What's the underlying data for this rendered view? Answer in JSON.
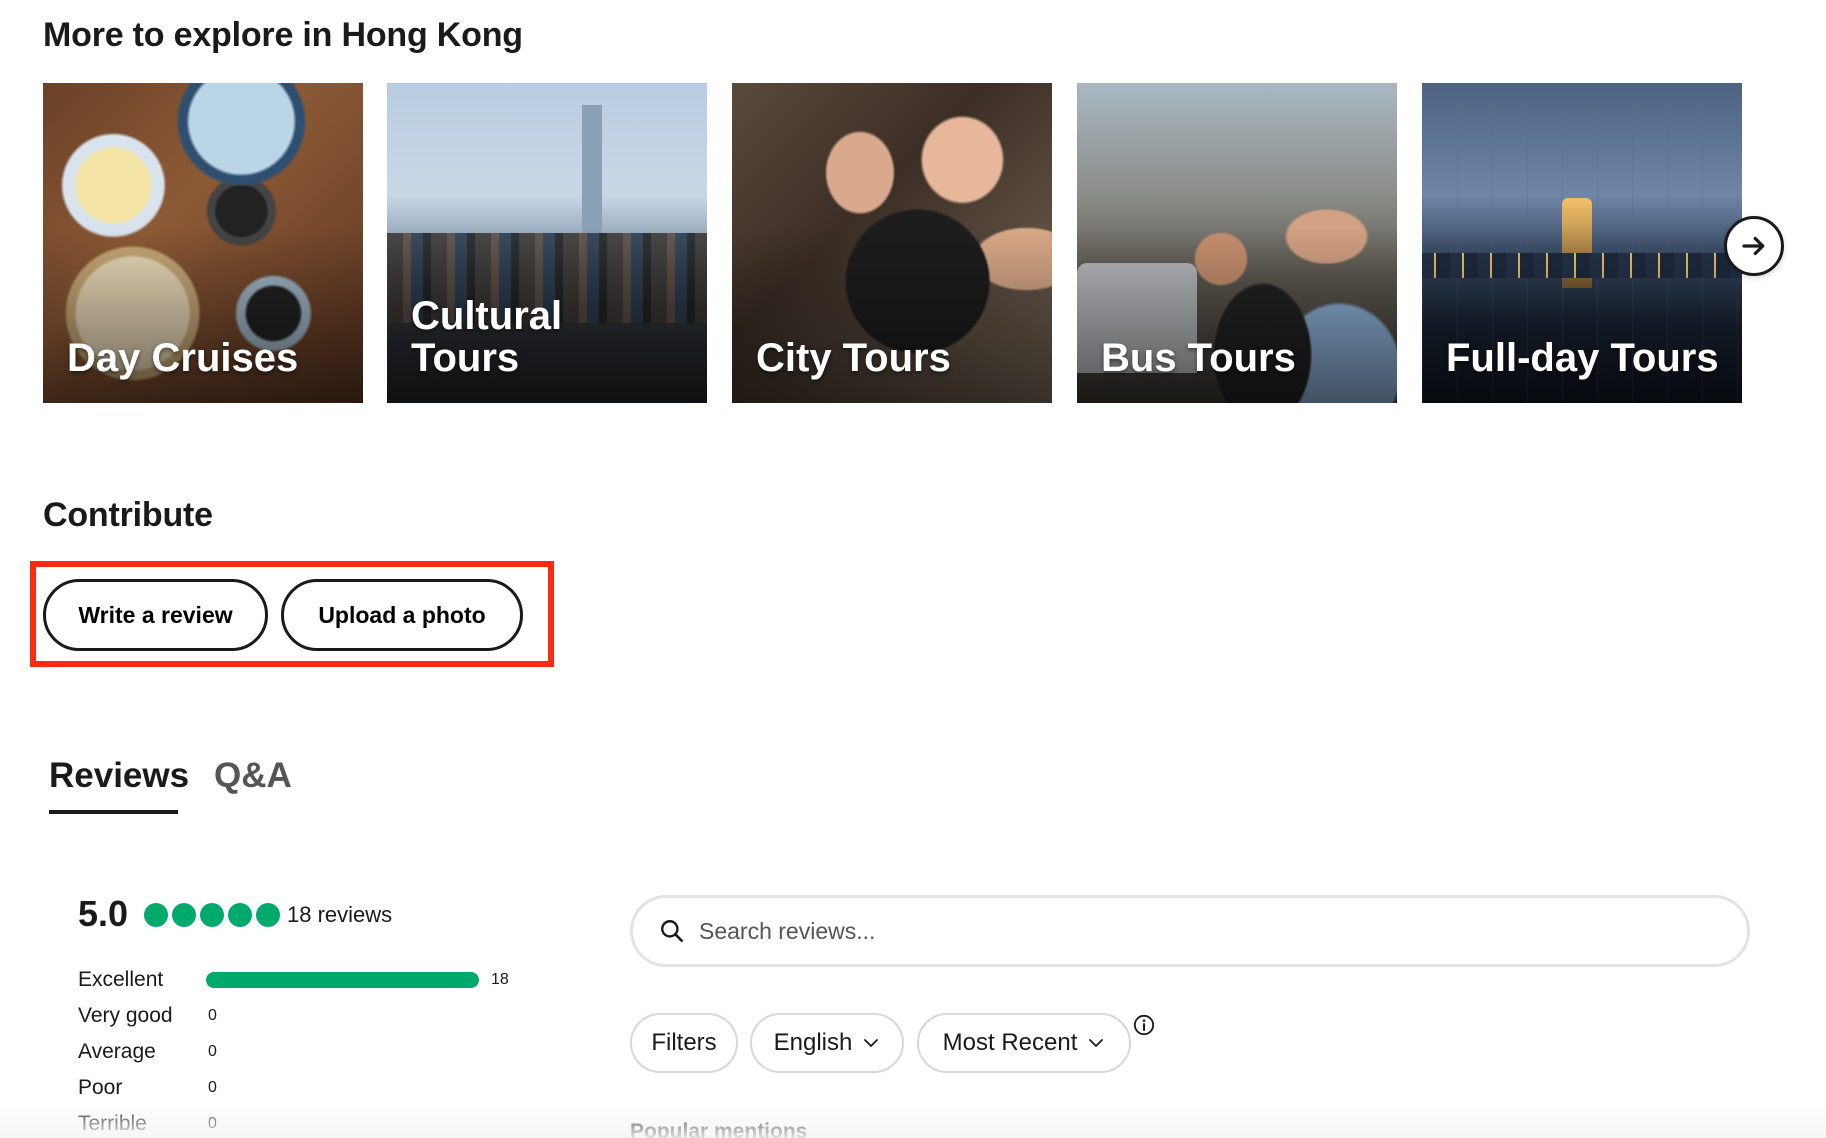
{
  "explore": {
    "title": "More to explore in Hong Kong",
    "cards": [
      {
        "label": "Day Cruises"
      },
      {
        "label": "Cultural Tours"
      },
      {
        "label": "City Tours"
      },
      {
        "label": "Bus Tours"
      },
      {
        "label": "Full-day Tours"
      }
    ],
    "next_icon": "arrow-right-icon"
  },
  "contribute": {
    "title": "Contribute",
    "write_review_label": "Write a review",
    "upload_photo_label": "Upload a photo",
    "highlight_color": "#ff2a12"
  },
  "tabs": {
    "reviews_label": "Reviews",
    "qa_label": "Q&A",
    "active": "Reviews"
  },
  "rating": {
    "score": "5.0",
    "bubbles_filled": 5,
    "bubbles_total": 5,
    "review_count": "18 reviews",
    "bubble_color": "#00aa6c",
    "distribution": [
      {
        "label": "Excellent",
        "count": "18",
        "fraction": 1.0
      },
      {
        "label": "Very good",
        "count": "0",
        "fraction": 0
      },
      {
        "label": "Average",
        "count": "0",
        "fraction": 0
      },
      {
        "label": "Poor",
        "count": "0",
        "fraction": 0
      },
      {
        "label": "Terrible",
        "count": "0",
        "fraction": 0
      }
    ]
  },
  "search": {
    "placeholder": "Search reviews...",
    "icon": "search-icon"
  },
  "filters": {
    "filters_label": "Filters",
    "language_label": "English",
    "sort_label": "Most Recent",
    "info_icon": "info-icon"
  },
  "popular_mentions": {
    "title": "Popular mentions"
  }
}
